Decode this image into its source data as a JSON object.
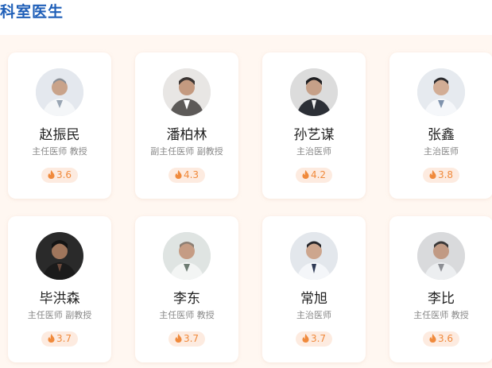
{
  "section_title": "科室医生",
  "doctors": [
    {
      "name": "赵振民",
      "title": "主任医师 教授",
      "rating": "3.6"
    },
    {
      "name": "潘柏林",
      "title": "副主任医师 副教授",
      "rating": "4.3"
    },
    {
      "name": "孙艺谋",
      "title": "主治医师",
      "rating": "4.2"
    },
    {
      "name": "张鑫",
      "title": "主治医师",
      "rating": "3.8"
    },
    {
      "name": "毕洪森",
      "title": "主任医师 副教授",
      "rating": "3.7"
    },
    {
      "name": "李东",
      "title": "主任医师 教授",
      "rating": "3.7"
    },
    {
      "name": "常旭",
      "title": "主治医师",
      "rating": "3.7"
    },
    {
      "name": "李比",
      "title": "主任医师 教授",
      "rating": "3.6"
    }
  ],
  "colors": {
    "title": "#1f5fb8",
    "panel_background": "#fff7f1",
    "rating_text": "#f08a3c",
    "rating_background": "#fdebe0"
  },
  "icons": {
    "rating": "flame-icon",
    "avatar": "doctor-avatar-photo"
  }
}
